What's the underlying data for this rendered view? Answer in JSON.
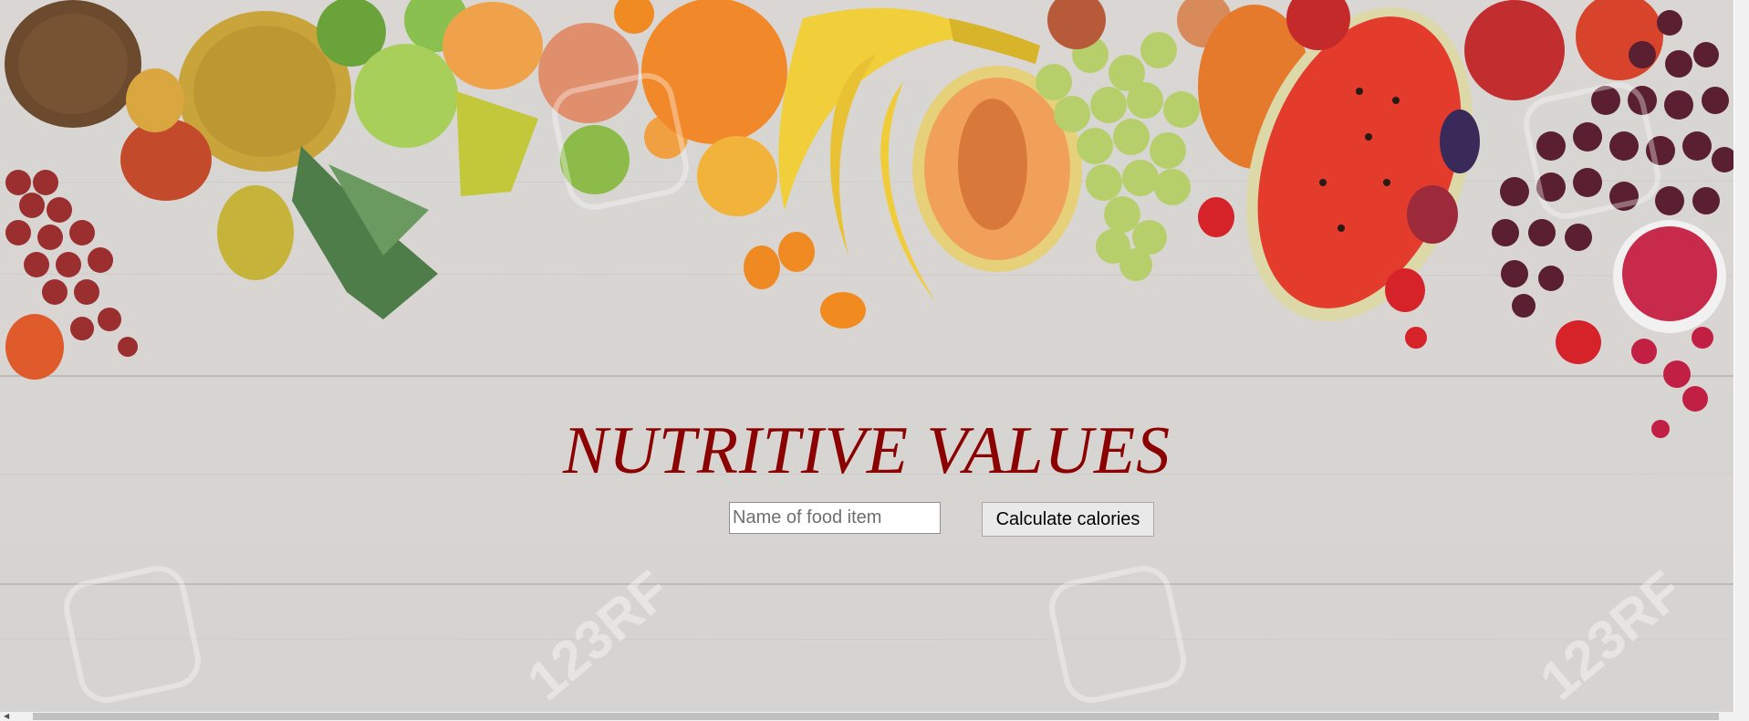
{
  "page": {
    "title": "NUTRITIVE VALUES",
    "title_color": "#8b0000"
  },
  "search": {
    "placeholder": "Name of food item",
    "value": ""
  },
  "actions": {
    "calculate_label": "Calculate calories"
  },
  "background": {
    "description_icon": "fruit-banner-image",
    "watermark": "123RF"
  },
  "scrollbars": {
    "left_arrow_icon": "arrow-left-icon"
  }
}
